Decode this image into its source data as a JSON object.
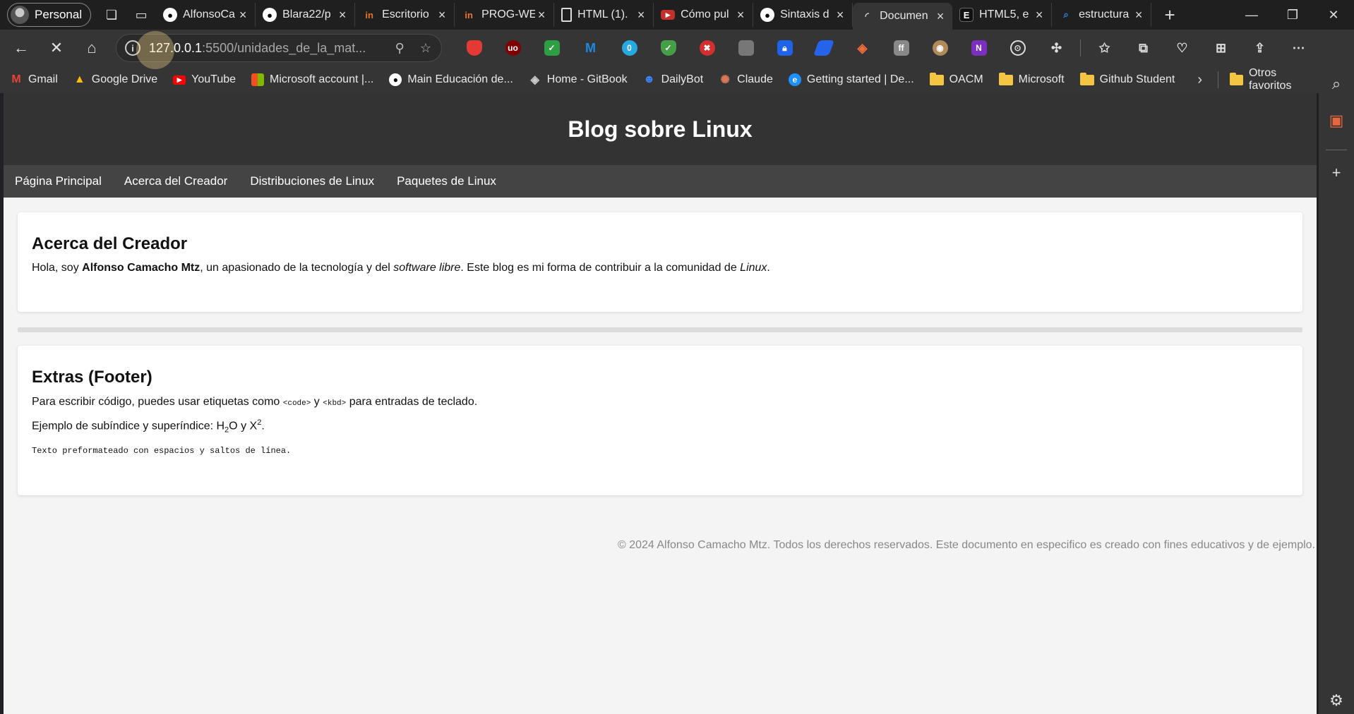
{
  "browser": {
    "profile_label": "Personal",
    "tabs": [
      {
        "label": "AlfonsoCa",
        "icon": "github-icon",
        "color": "#ffffff"
      },
      {
        "label": "Blara22/p",
        "icon": "github-icon",
        "color": "#ffffff"
      },
      {
        "label": "Escritorio",
        "icon": "in-icon",
        "color": "#e87722"
      },
      {
        "label": "PROG-WE",
        "icon": "in-icon",
        "color": "#e87722"
      },
      {
        "label": "HTML (1).",
        "icon": "document-icon",
        "color": "#dddddd"
      },
      {
        "label": "Cómo pul",
        "icon": "youtube-icon",
        "color": "#c4302b"
      },
      {
        "label": "Sintaxis d",
        "icon": "github-icon",
        "color": "#ffffff"
      },
      {
        "label": "Documen",
        "icon": "loading-icon",
        "color": "#dddddd",
        "active": true
      },
      {
        "label": "HTML5, e",
        "icon": "e-icon",
        "color": "#111111"
      },
      {
        "label": "estructura",
        "icon": "search-icon",
        "color": "#3b82f6"
      }
    ],
    "url_host": "127.0.0.1",
    "url_path": ":5500/unidades_de_la_mat...",
    "bookmarks": [
      {
        "label": "Gmail",
        "icon": "gmail-icon",
        "color": "#ea4335"
      },
      {
        "label": "Google Drive",
        "icon": "drive-icon",
        "color": "#34a853"
      },
      {
        "label": "YouTube",
        "icon": "youtube-icon",
        "color": "#ff0000"
      },
      {
        "label": "Microsoft account |...",
        "icon": "microsoft-icon",
        "color": "#f25022"
      },
      {
        "label": "Main Educación de...",
        "icon": "github-icon",
        "color": "#ffffff"
      },
      {
        "label": "Home - GitBook",
        "icon": "gitbook-icon",
        "color": "#cccccc"
      },
      {
        "label": "DailyBot",
        "icon": "dailybot-icon",
        "color": "#3b82f6"
      },
      {
        "label": "Claude",
        "icon": "claude-icon",
        "color": "#d97757"
      },
      {
        "label": "Getting started | De...",
        "icon": "edge-icon",
        "color": "#1e90ff"
      },
      {
        "label": "OACM",
        "icon": "folder-icon",
        "color": "#f4c542"
      },
      {
        "label": "Microsoft",
        "icon": "folder-icon",
        "color": "#f4c542"
      },
      {
        "label": "Github Student",
        "icon": "folder-icon",
        "color": "#f4c542"
      }
    ],
    "other_favorites": "Otros favoritos"
  },
  "page": {
    "header_title": "Blog sobre Linux",
    "nav": [
      "Página Principal",
      "Acerca del Creador",
      "Distribuciones de Linux",
      "Paquetes de Linux"
    ],
    "about": {
      "heading": "Acerca del Creador",
      "t1": "Hola, soy ",
      "name": "Alfonso Camacho Mtz",
      "t2": ", un apasionado de la tecnología y del ",
      "em1": "software libre",
      "t3": ". Este blog es mi forma de contribuir a la comunidad de ",
      "em2": "Linux",
      "t4": "."
    },
    "extras": {
      "heading": "Extras (Footer)",
      "p1_a": "Para escribir código, puedes usar etiquetas como ",
      "code1": "<code>",
      "p1_b": " y ",
      "code2": "<kbd>",
      "p1_c": " para entradas de teclado.",
      "p2_a": "Ejemplo de subíndice y superíndice: H",
      "sub": "2",
      "p2_b": "O y X",
      "sup": "2",
      "p2_c": ".",
      "pre": "Texto preformateado con espacios y saltos de línea."
    },
    "footer": "© 2024 Alfonso Camacho Mtz. Todos los derechos reservados. Este documento en especifico es creado con fines educativos y de ejemplo."
  }
}
